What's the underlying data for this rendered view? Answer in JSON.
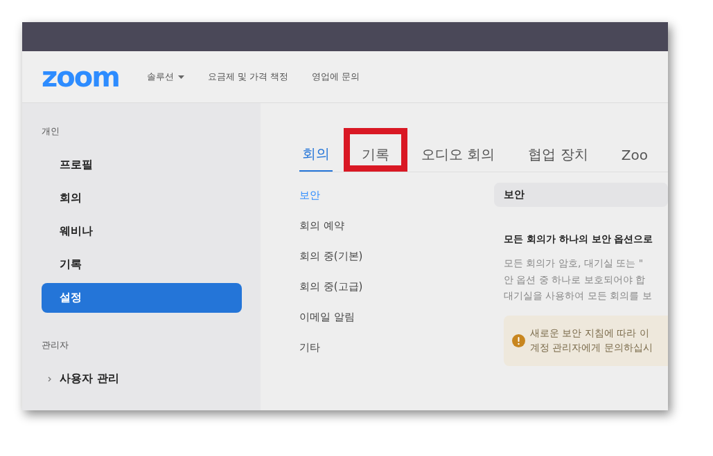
{
  "header": {
    "logo": "zoom",
    "nav": [
      {
        "label": "솔루션",
        "dropdown": true
      },
      {
        "label": "요금제 및 가격 책정",
        "dropdown": false
      },
      {
        "label": "영업에 문의",
        "dropdown": false
      }
    ]
  },
  "sidebar": {
    "groups": [
      {
        "label": "개인",
        "items": [
          {
            "label": "프로필",
            "selected": false,
            "kind": "link"
          },
          {
            "label": "회의",
            "selected": false,
            "kind": "link"
          },
          {
            "label": "웨비나",
            "selected": false,
            "kind": "link"
          },
          {
            "label": "기록",
            "selected": false,
            "kind": "link"
          },
          {
            "label": "설정",
            "selected": true,
            "kind": "link"
          }
        ]
      },
      {
        "label": "관리자",
        "items": [
          {
            "label": "사용자 관리",
            "selected": false,
            "kind": "expander",
            "expanded": false
          }
        ]
      }
    ]
  },
  "tabs": [
    {
      "label": "회의",
      "selected": true,
      "highlighted": false
    },
    {
      "label": "기록",
      "selected": false,
      "highlighted": true
    },
    {
      "label": "오디오 회의",
      "selected": false,
      "highlighted": false
    },
    {
      "label": "협업 장치",
      "selected": false,
      "highlighted": false
    },
    {
      "label": "Zoo",
      "selected": false,
      "highlighted": false
    }
  ],
  "section_nav": [
    {
      "label": "보안",
      "selected": true
    },
    {
      "label": "회의 예약",
      "selected": false
    },
    {
      "label": "회의 중(기본)",
      "selected": false
    },
    {
      "label": "회의 중(고급)",
      "selected": false
    },
    {
      "label": "이메일 알림",
      "selected": false
    },
    {
      "label": "기타",
      "selected": false
    }
  ],
  "panel": {
    "title": "보안",
    "setting_title": "모든 회의가 하나의 보안 옵션으로",
    "description": [
      "모든 회의가 암호, 대기실 또는 \"",
      "안 옵션 중 하나로 보호되어야 합",
      "대기실을 사용하여 모든 회의를 보"
    ],
    "notice": [
      "새로운 보안 지침에 따라 이",
      "계정 관리자에게 문의하십시"
    ]
  }
}
